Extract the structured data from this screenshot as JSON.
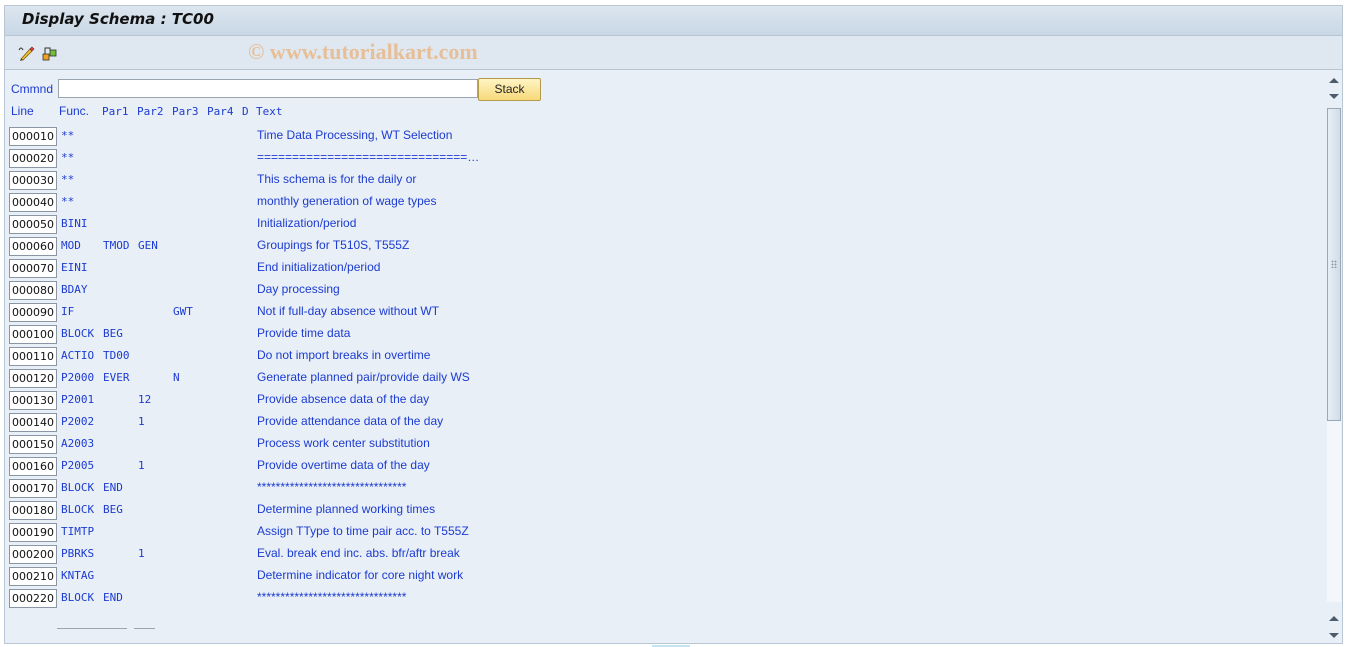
{
  "window": {
    "title": "Display Schema : TC00",
    "watermark": "© www.tutorialkart.com"
  },
  "toolbar": {
    "icons": [
      "display-change-icon",
      "other-object-icon"
    ]
  },
  "command": {
    "label": "Cmmnd",
    "value": "",
    "placeholder": "",
    "stack_label": "Stack"
  },
  "columns": {
    "line": "Line",
    "func": "Func.",
    "par1": "Par1",
    "par2": "Par2",
    "par3": "Par3",
    "par4": "Par4",
    "d": "D",
    "text": "Text"
  },
  "rows": [
    {
      "line": "000010",
      "func": "**",
      "par1": "",
      "par2": "",
      "par3": "",
      "par4": "",
      "d": "",
      "text": "Time Data Processing, WT Selection"
    },
    {
      "line": "000020",
      "func": "**",
      "par1": "",
      "par2": "",
      "par3": "",
      "par4": "",
      "d": "",
      "text": "==============================…"
    },
    {
      "line": "000030",
      "func": "**",
      "par1": "",
      "par2": "",
      "par3": "",
      "par4": "",
      "d": "",
      "text": "This schema is for the daily or"
    },
    {
      "line": "000040",
      "func": "**",
      "par1": "",
      "par2": "",
      "par3": "",
      "par4": "",
      "d": "",
      "text": "monthly generation of wage types"
    },
    {
      "line": "000050",
      "func": "BINI",
      "par1": "",
      "par2": "",
      "par3": "",
      "par4": "",
      "d": "",
      "text": "Initialization/period"
    },
    {
      "line": "000060",
      "func": "MOD",
      "par1": "TMOD",
      "par2": "GEN",
      "par3": "",
      "par4": "",
      "d": "",
      "text": "Groupings for T510S, T555Z"
    },
    {
      "line": "000070",
      "func": "EINI",
      "par1": "",
      "par2": "",
      "par3": "",
      "par4": "",
      "d": "",
      "text": "End initialization/period"
    },
    {
      "line": "000080",
      "func": "BDAY",
      "par1": "",
      "par2": "",
      "par3": "",
      "par4": "",
      "d": "",
      "text": "Day processing"
    },
    {
      "line": "000090",
      "func": "IF",
      "par1": "",
      "par2": "",
      "par3": "GWT",
      "par4": "",
      "d": "",
      "text": "Not if full-day absence without WT"
    },
    {
      "line": "000100",
      "func": "BLOCK",
      "par1": "BEG",
      "par2": "",
      "par3": "",
      "par4": "",
      "d": "",
      "text": "Provide time data"
    },
    {
      "line": "000110",
      "func": "ACTIO",
      "par1": "TD00",
      "par2": "",
      "par3": "",
      "par4": "",
      "d": "",
      "text": "Do not import breaks in overtime"
    },
    {
      "line": "000120",
      "func": "P2000",
      "par1": "EVER",
      "par2": "",
      "par3": "N",
      "par4": "",
      "d": "",
      "text": "Generate planned pair/provide daily WS"
    },
    {
      "line": "000130",
      "func": "P2001",
      "par1": "",
      "par2": "12",
      "par3": "",
      "par4": "",
      "d": "",
      "text": "Provide absence data of the day"
    },
    {
      "line": "000140",
      "func": "P2002",
      "par1": "",
      "par2": "1",
      "par3": "",
      "par4": "",
      "d": "",
      "text": "Provide attendance data of the day"
    },
    {
      "line": "000150",
      "func": "A2003",
      "par1": "",
      "par2": "",
      "par3": "",
      "par4": "",
      "d": "",
      "text": "Process work center substitution"
    },
    {
      "line": "000160",
      "func": "P2005",
      "par1": "",
      "par2": "1",
      "par3": "",
      "par4": "",
      "d": "",
      "text": "Provide overtime data of the day"
    },
    {
      "line": "000170",
      "func": "BLOCK",
      "par1": "END",
      "par2": "",
      "par3": "",
      "par4": "",
      "d": "",
      "text": "********************************"
    },
    {
      "line": "000180",
      "func": "BLOCK",
      "par1": "BEG",
      "par2": "",
      "par3": "",
      "par4": "",
      "d": "",
      "text": "Determine planned working times"
    },
    {
      "line": "000190",
      "func": "TIMTP",
      "par1": "",
      "par2": "",
      "par3": "",
      "par4": "",
      "d": "",
      "text": "Assign TType to time pair acc. to T555Z"
    },
    {
      "line": "000200",
      "func": "PBRKS",
      "par1": "",
      "par2": "1",
      "par3": "",
      "par4": "",
      "d": "",
      "text": "Eval. break end inc. abs. bfr/aftr break"
    },
    {
      "line": "000210",
      "func": "KNTAG",
      "par1": "",
      "par2": "",
      "par3": "",
      "par4": "",
      "d": "",
      "text": "Determine indicator for core night work"
    },
    {
      "line": "000220",
      "func": "BLOCK",
      "par1": "END",
      "par2": "",
      "par3": "",
      "par4": "",
      "d": "",
      "text": "********************************"
    }
  ],
  "colors": {
    "text_blue": "#1c3bd1",
    "background": "#e8eff7",
    "stack_button": "#f7d97a"
  }
}
